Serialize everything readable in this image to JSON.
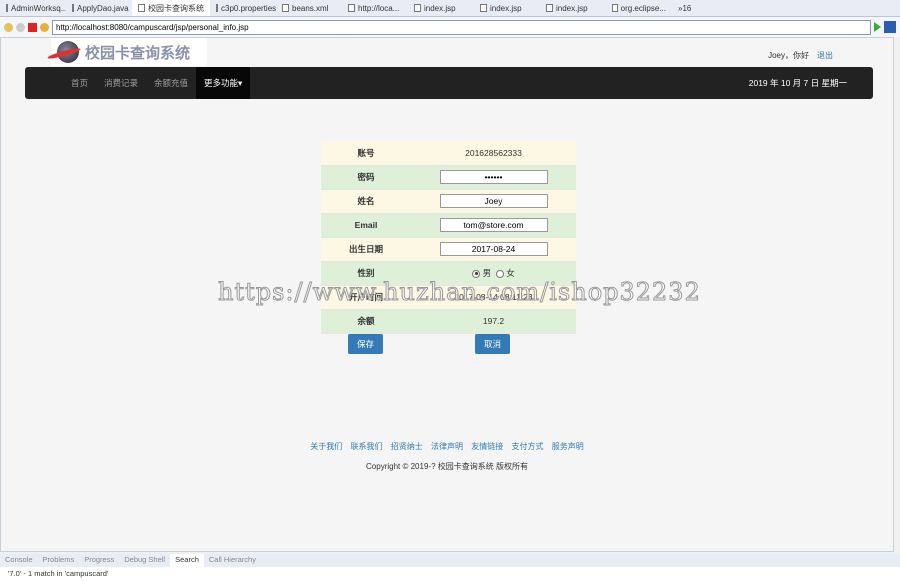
{
  "editor_tabs": [
    "AdminWorksq...",
    "ApplyDao.java",
    "校园卡查询系统",
    "c3p0.properties",
    "beans.xml",
    "http://loca...",
    "index.jsp",
    "index.jsp",
    "index.jsp",
    "org.eclipse...",
    "»16"
  ],
  "url": "http://localhost:8080/campuscard/jsp/personal_info.jsp",
  "logo_text": "校园卡查询系统",
  "user": {
    "greeting": "Joey，你好",
    "logout": "退出"
  },
  "nav": {
    "items": [
      "首页",
      "消费记录",
      "余额充值"
    ],
    "more": "更多功能▾",
    "date": "2019 年 10 月 7 日 星期一"
  },
  "form": {
    "account_label": "账号",
    "account": "201628562333",
    "password_label": "密码",
    "password": "••••••",
    "name_label": "姓名",
    "name": "Joey",
    "email_label": "Email",
    "email": "tom@store.com",
    "birth_label": "出生日期",
    "birth": "2017-08-24",
    "gender_label": "性别",
    "male": "男",
    "female": "女",
    "created_label": "开户时间",
    "created": "2017-08-14 08:11:23",
    "balance_label": "余额",
    "balance": "197.2",
    "save": "保存",
    "cancel": "取消"
  },
  "footer": {
    "links": [
      "关于我们",
      "联系我们",
      "招贤纳士",
      "法律声明",
      "友情链接",
      "支付方式",
      "服务声明"
    ],
    "copyright": "Copyright © 2019-? 校园卡查询系统 版权所有"
  },
  "watermark": "https://www.huzhan.com/ishop32232",
  "bottom_tabs": [
    "Console",
    "Problems",
    "Progress",
    "Debug Shell",
    "Search",
    "Call Hierarchy"
  ],
  "status": "'7.0' - 1 match in 'campuscard'"
}
